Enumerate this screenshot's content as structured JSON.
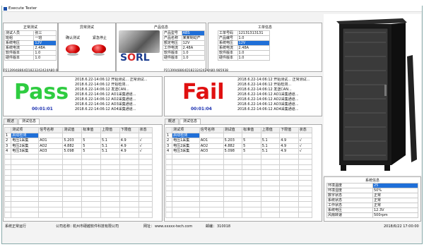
{
  "window": {
    "title": "Execute Tester"
  },
  "normal_test": {
    "title": "正常测试",
    "rows": [
      {
        "label": "测试人员",
        "value": "张三"
      },
      {
        "label": "班组",
        "value": "一班"
      },
      {
        "label": "系统电压",
        "value": "12V"
      },
      {
        "label": "系统电流",
        "value": "2.48A"
      },
      {
        "label": "软件版本",
        "value": "1.0"
      },
      {
        "label": "硬件版本",
        "value": "1.0"
      }
    ],
    "barcode": "P2139948864D1823242424A80-985938"
  },
  "abnormal_test": {
    "title": "异常测试",
    "start_label": "确认测试",
    "stop_label": "紧急停止"
  },
  "product_info": {
    "title": "产品信息",
    "rows": [
      {
        "label": "产品型号",
        "value": "ABS"
      },
      {
        "label": "产品名称",
        "value": "某某制动产"
      },
      {
        "label": "额定电压",
        "value": "12V"
      },
      {
        "label": "工作电流",
        "value": "2.48A"
      },
      {
        "label": "软件版本",
        "value": "1.0"
      },
      {
        "label": "硬件版本",
        "value": "1.0"
      }
    ],
    "logo": "SORL"
  },
  "station_info": {
    "title": "工单信息",
    "rows": [
      {
        "label": "工单号码",
        "value": "12131313131"
      },
      {
        "label": "产品编号",
        "value": "1.0"
      },
      {
        "label": "系统电压",
        "value": "12V"
      },
      {
        "label": "系统电流",
        "value": "2.48A"
      },
      {
        "label": "软件版本",
        "value": "1.0"
      },
      {
        "label": "硬件版本",
        "value": "1.0"
      }
    ],
    "barcode": "P2139948864D1823242424A80-985938"
  },
  "left_result": {
    "status": "Pass",
    "timer": "00:01:01",
    "log": [
      "2018.6.22-14:06:12 开始测试...  正常测试...",
      "2018.6.22-14:06:12 开始检测...",
      "2018.6.22-14:06:12 发送CAN...",
      "2018.6.22-14:06:12 AO1采集通道...",
      "2018.6.22-14:06:12 AO2采集通道...",
      "2018.6.22-14:06:12 AO3采集通道...",
      "2018.6.22-14:06:12 AO4采集通道..."
    ]
  },
  "right_result": {
    "status": "Fail",
    "timer": "00:01:04",
    "log": [
      "2018.6.22-14:06:12 开始测试...  正常测试...",
      "2018.6.22-14:06:12 开始检测...",
      "2018.6.22-14:06:12 发送CAN...",
      "2018.6.22-14:06:12 AO1采集通道...",
      "2018.6.22-14:06:12 AO2采集通道...",
      "2018.6.22-14:06:12 AO3采集通道...",
      "2018.6.22-14:06:12 AO4采集通道..."
    ]
  },
  "left_table": {
    "tabs": [
      "概述",
      "测试信息"
    ],
    "columns": [
      "",
      "测试项",
      "信号名称",
      "测试值",
      "标准值",
      "上限值",
      "下限值",
      "状态"
    ],
    "rows": [
      [
        "1",
        "启动检测",
        "",
        "",
        "",
        "",
        "",
        ""
      ],
      [
        "2",
        "电压1采集",
        "AO1",
        "5.203",
        "5",
        "5.1",
        "4.9",
        "√"
      ],
      [
        "3",
        "电压2采集",
        "AO2",
        "4.882",
        "5",
        "5.1",
        "4.9",
        "√"
      ],
      [
        "4",
        "电压3采集",
        "AO3",
        "5.098",
        "5",
        "5.1",
        "4.9",
        "√"
      ]
    ]
  },
  "right_table": {
    "tabs": [
      "概述",
      "测试信息"
    ],
    "columns": [
      "",
      "测试项",
      "信号名称",
      "测试值",
      "标准值",
      "上限值",
      "下限值",
      "状态"
    ],
    "rows": [
      [
        "1",
        "启动检测",
        "",
        "",
        "",
        "",
        "",
        ""
      ],
      [
        "2",
        "电压1采集",
        "AO1",
        "5.203",
        "5",
        "5.1",
        "4.9",
        "√"
      ],
      [
        "3",
        "电压2采集",
        "AO2",
        "4.882",
        "5",
        "5.1",
        "4.9",
        "√"
      ],
      [
        "4",
        "电压3采集",
        "AO3",
        "5.098",
        "5",
        "5.1",
        "4.9",
        "√"
      ]
    ]
  },
  "system_info": {
    "title": "系统信息",
    "rows": [
      {
        "label": "环境温度",
        "value": "25"
      },
      {
        "label": "环境湿度",
        "value": "50%"
      },
      {
        "label": "数字状态",
        "value": "正常"
      },
      {
        "label": "系统状态",
        "value": "正常"
      },
      {
        "label": "工作状态",
        "value": "正常"
      },
      {
        "label": "系统电压",
        "value": "12.3V"
      },
      {
        "label": "风扇转速",
        "value": "500rpm"
      }
    ]
  },
  "status_bar": {
    "left": "系统正常运行",
    "company_label": "公司名称：",
    "company": "杭州市硬越软件科技有限公司",
    "website_label": "网址：",
    "website": "www.xxxxx-tech.com",
    "postcode_label": "邮编：",
    "postcode": "310018",
    "datetime": "2018/6/22 17:00:00"
  },
  "colors": {
    "pass": "#2ecc40",
    "fail": "#e01010",
    "timer": "#1a2fb0",
    "select": "#1f6fd8"
  }
}
